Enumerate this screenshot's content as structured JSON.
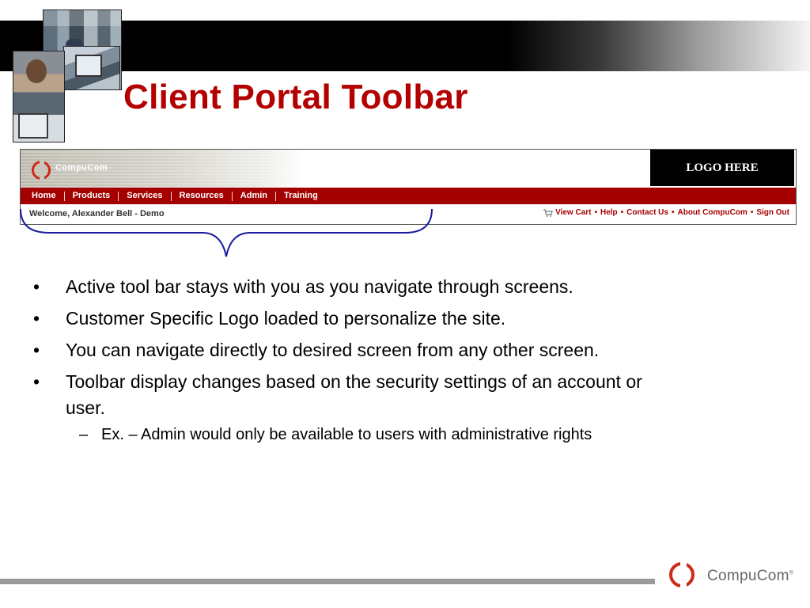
{
  "title": "Client Portal Toolbar",
  "portal": {
    "brand": "CompuCom",
    "logo_placeholder": "LOGO HERE",
    "nav": [
      "Home",
      "Products",
      "Services",
      "Resources",
      "Admin",
      "Training"
    ],
    "welcome": "Welcome, Alexander Bell - Demo",
    "links": [
      "View Cart",
      "Help",
      "Contact Us",
      "About CompuCom",
      "Sign Out"
    ],
    "separator": "•"
  },
  "bullets": [
    "Active tool bar stays with you as you navigate through screens.",
    "Customer Specific Logo loaded to personalize the site.",
    "You can navigate directly to desired screen from any other screen.",
    "Toolbar display changes based on the security settings of an account or user."
  ],
  "bullet_mark": "•",
  "sub_bullet": "Ex. – Admin would only be available to users with administrative rights",
  "sub_bullet_mark": "–",
  "footer": {
    "brand": "CompuCom",
    "reg": "®"
  },
  "colors": {
    "title": "#b30000",
    "nav_bar": "#a50000",
    "brace": "#1a1aa0"
  }
}
